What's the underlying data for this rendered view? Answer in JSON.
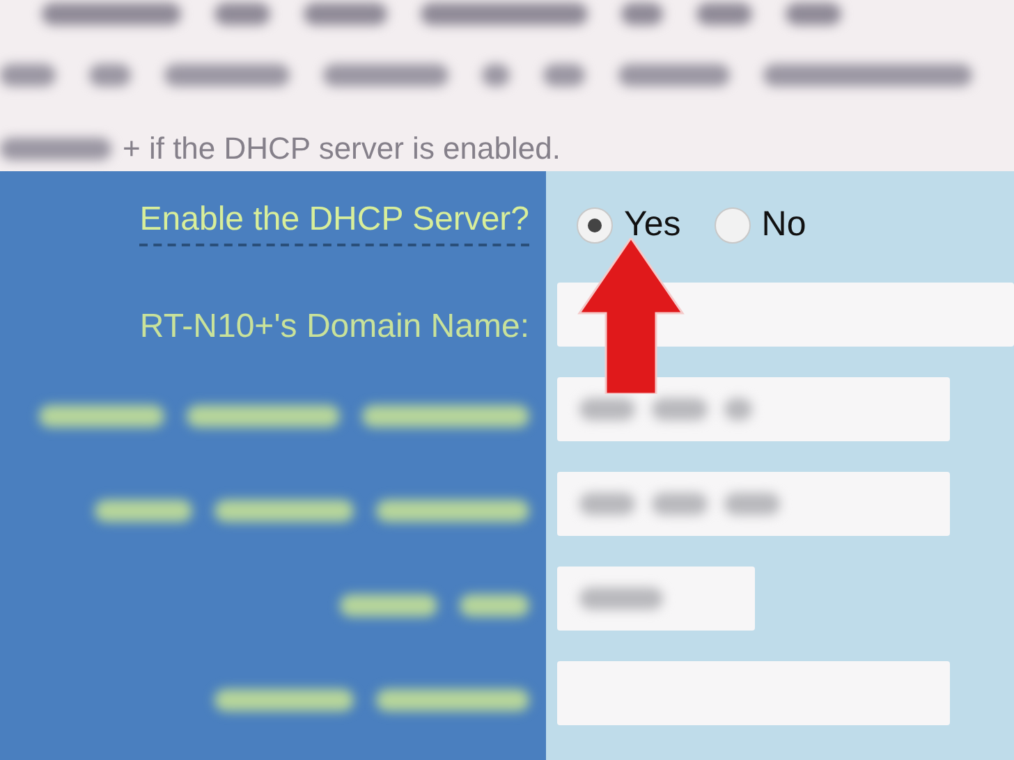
{
  "intro": {
    "note": "+ if the DHCP server is enabled."
  },
  "dhcp": {
    "label": "Enable the DHCP Server?",
    "options": [
      {
        "label": "Yes",
        "selected": true
      },
      {
        "label": "No",
        "selected": false
      }
    ]
  },
  "fields": [
    {
      "kind": "clear",
      "label": "RT-N10+'s Domain Name:"
    },
    {
      "kind": "blurred"
    },
    {
      "kind": "blurred"
    },
    {
      "kind": "blurred"
    },
    {
      "kind": "blurred"
    }
  ]
}
